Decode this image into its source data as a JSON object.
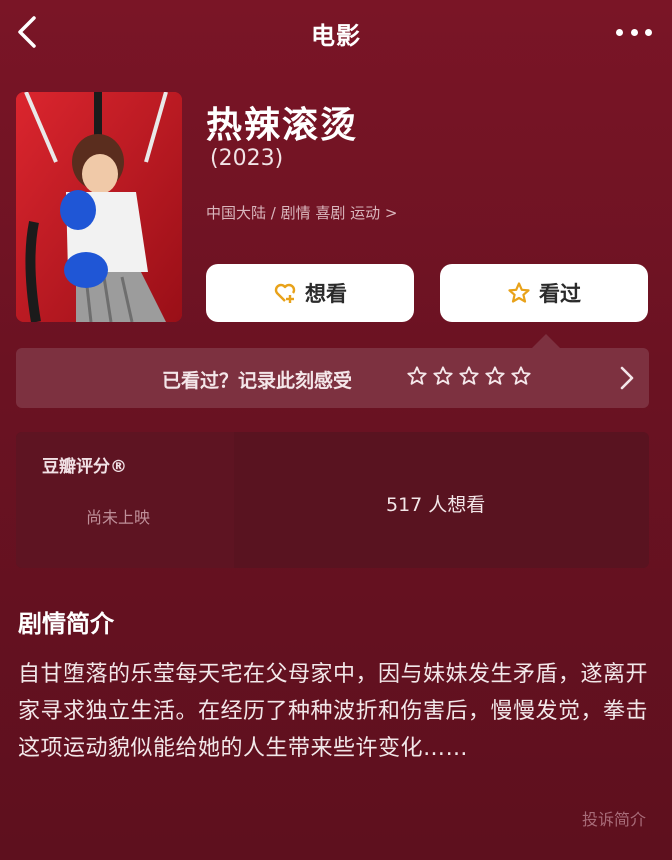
{
  "header": {
    "title": "电影",
    "back_icon": "chevron-left-icon",
    "more_icon": "more-dots-icon"
  },
  "movie": {
    "title": "热辣滚烫",
    "year": "(2023)",
    "meta": "中国大陆 / 剧情 喜剧 运动 >"
  },
  "actions": {
    "want_label": "想看",
    "seen_label": "看过"
  },
  "rating_prompt": {
    "text": "已看过？记录此刻感受",
    "stars": 5
  },
  "score": {
    "label": "豆瓣评分®",
    "status": "尚未上映",
    "want_count": "517 人想看"
  },
  "synopsis": {
    "heading": "剧情简介",
    "text": "自甘堕落的乐莹每天宅在父母家中，因与妹妹发生矛盾，遂离开家寻求独立生活。在经历了种种波折和伤害后，慢慢发觉，拳击这项运动貌似能给她的人生带来些许变化……",
    "report_label": "投诉简介"
  },
  "colors": {
    "background": "#6a1222",
    "rating_bar": "#7d3140",
    "score_card": "#591320",
    "button": "#ffffff",
    "icon_gold": "#e8a21a"
  }
}
